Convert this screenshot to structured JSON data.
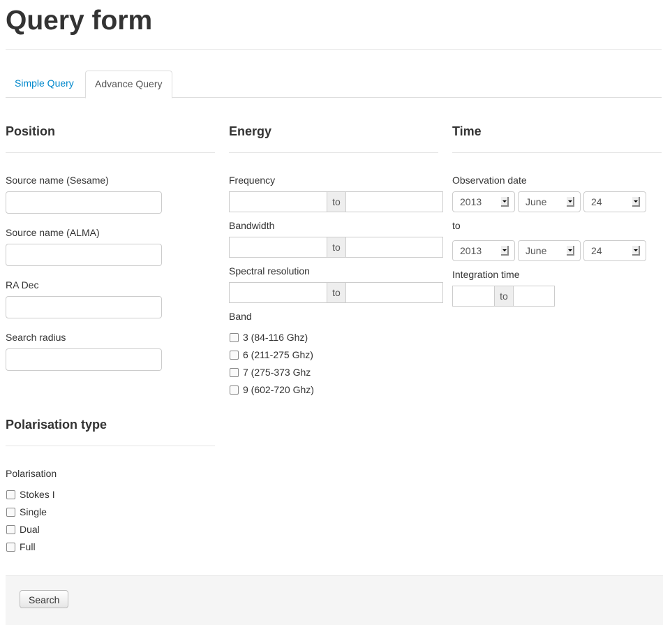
{
  "title": "Query form",
  "tabs": [
    {
      "label": "Simple Query"
    },
    {
      "label": "Advance Query"
    }
  ],
  "position": {
    "heading": "Position",
    "fields": [
      {
        "label": "Source name (Sesame)",
        "value": ""
      },
      {
        "label": "Source name (ALMA)",
        "value": ""
      },
      {
        "label": "RA Dec",
        "value": ""
      },
      {
        "label": "Search radius",
        "value": ""
      }
    ]
  },
  "energy": {
    "heading": "Energy",
    "ranges": [
      {
        "label": "Frequency",
        "to": "to"
      },
      {
        "label": "Bandwidth",
        "to": "to"
      },
      {
        "label": "Spectral resolution",
        "to": "to"
      }
    ],
    "band_label": "Band",
    "bands": [
      "3 (84-116 Ghz)",
      "6 (211-275 Ghz)",
      "7 (275-373 Ghz",
      "9 (602-720 Ghz)"
    ]
  },
  "time": {
    "heading": "Time",
    "obs_label": "Observation date",
    "from": {
      "year": "2013",
      "month": "June",
      "day": "24"
    },
    "to_label": "to",
    "to": {
      "year": "2013",
      "month": "June",
      "day": "24"
    },
    "integration_label": "Integration time",
    "integration_to": "to"
  },
  "polarisation": {
    "heading": "Polarisation type",
    "label": "Polarisation",
    "options": [
      "Stokes I",
      "Single",
      "Dual",
      "Full"
    ]
  },
  "search_label": "Search"
}
